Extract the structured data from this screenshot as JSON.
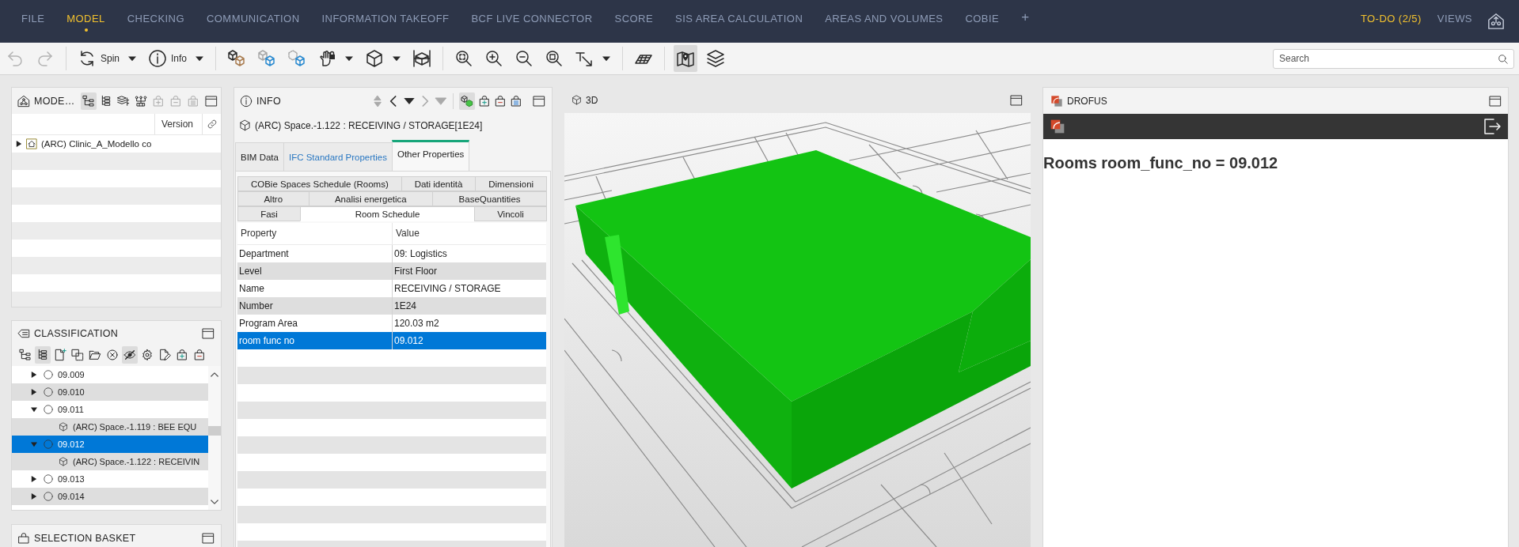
{
  "menu_bar": {
    "items": [
      {
        "label": "FILE",
        "selected": false
      },
      {
        "label": "MODEL",
        "selected": true
      },
      {
        "label": "CHECKING",
        "selected": false
      },
      {
        "label": "COMMUNICATION",
        "selected": false
      },
      {
        "label": "INFORMATION TAKEOFF",
        "selected": false
      },
      {
        "label": "BCF LIVE CONNECTOR",
        "selected": false
      },
      {
        "label": "SCORE",
        "selected": false
      },
      {
        "label": "SIS AREA CALCULATION",
        "selected": false
      },
      {
        "label": "AREAS AND VOLUMES",
        "selected": false
      },
      {
        "label": "COBIE",
        "selected": false
      }
    ],
    "add_label": "+",
    "right_items": [
      {
        "label": "TO-DO (2/5)",
        "highlighted": true
      },
      {
        "label": "VIEWS",
        "highlighted": false
      }
    ]
  },
  "toolbar": {
    "tool_groups": [
      [
        {
          "kind": "undo",
          "pressed": false,
          "disabled": true,
          "dropdown": false
        },
        {
          "kind": "redo",
          "pressed": false,
          "disabled": true,
          "dropdown": false
        }
      ],
      [
        {
          "kind": "rotate",
          "label": "Spin",
          "pressed": false,
          "disabled": false,
          "dropdown": true
        },
        {
          "kind": "info",
          "label": "Info",
          "pressed": false,
          "disabled": false,
          "dropdown": true
        }
      ],
      [
        {
          "kind": "cubes",
          "pressed": false,
          "disabled": false,
          "dropdown": false
        },
        {
          "kind": "cubes-ghost",
          "pressed": false,
          "disabled": false,
          "dropdown": false
        },
        {
          "kind": "cubes-dashed",
          "pressed": false,
          "disabled": false,
          "dropdown": false
        },
        {
          "kind": "hand-lock",
          "pressed": false,
          "disabled": false,
          "dropdown": true
        },
        {
          "kind": "cube",
          "pressed": false,
          "disabled": false,
          "dropdown": true
        },
        {
          "kind": "section-box",
          "pressed": false,
          "disabled": false,
          "dropdown": false
        }
      ],
      [
        {
          "kind": "zoom-fit",
          "pressed": false,
          "disabled": false,
          "dropdown": false
        },
        {
          "kind": "zoom-in",
          "pressed": false,
          "disabled": false,
          "dropdown": false
        },
        {
          "kind": "zoom-out",
          "pressed": false,
          "disabled": false,
          "dropdown": false
        },
        {
          "kind": "zoom-window",
          "pressed": false,
          "disabled": false,
          "dropdown": false
        },
        {
          "kind": "measure",
          "pressed": false,
          "disabled": false,
          "dropdown": true
        }
      ],
      [
        {
          "kind": "plane",
          "pressed": false,
          "disabled": false,
          "dropdown": false
        }
      ],
      [
        {
          "kind": "map",
          "pressed": true,
          "disabled": false,
          "dropdown": false
        },
        {
          "kind": "layers",
          "pressed": false,
          "disabled": false,
          "dropdown": false
        }
      ]
    ],
    "search": {
      "placeholder": "Search"
    }
  },
  "models_panel": {
    "title": "MODE…",
    "tools": [
      {
        "kind": "hierarchy",
        "pressed": true,
        "disabled": false
      },
      {
        "kind": "tree",
        "pressed": false,
        "disabled": false
      },
      {
        "kind": "layers-tree",
        "pressed": false,
        "disabled": false
      },
      {
        "kind": "network",
        "pressed": false,
        "disabled": false
      },
      {
        "kind": "bag-plus",
        "pressed": false,
        "disabled": true
      },
      {
        "kind": "bag-minus",
        "pressed": false,
        "disabled": true
      },
      {
        "kind": "bag-list",
        "pressed": false,
        "disabled": true
      }
    ],
    "columns": [
      "Version"
    ],
    "rows": [
      {
        "label": "(ARC) Clinic_A_Modello co",
        "expanded": false
      }
    ]
  },
  "classification_panel": {
    "title": "CLASSIFICATION",
    "tools": [
      {
        "kind": "hierarchy",
        "pressed": false,
        "disabled": false
      },
      {
        "kind": "tree",
        "pressed": true,
        "disabled": false
      },
      {
        "kind": "file-plus",
        "pressed": false,
        "disabled": false
      },
      {
        "kind": "copy-dashed",
        "pressed": false,
        "disabled": false
      },
      {
        "kind": "folder-open",
        "pressed": false,
        "disabled": false
      },
      {
        "kind": "circle-x",
        "pressed": false,
        "disabled": false
      },
      {
        "kind": "eye-slash",
        "pressed": true,
        "disabled": false
      },
      {
        "kind": "gear",
        "pressed": false,
        "disabled": false
      },
      {
        "kind": "edit-doc",
        "pressed": false,
        "disabled": false
      },
      {
        "kind": "bag-plus",
        "pressed": false,
        "disabled": false
      },
      {
        "kind": "bag-minus",
        "pressed": false,
        "disabled": false
      }
    ],
    "tree": [
      {
        "kind": "group",
        "label": "09.009",
        "expanded": false,
        "selected": false
      },
      {
        "kind": "group",
        "label": "09.010",
        "expanded": false,
        "selected": false
      },
      {
        "kind": "group",
        "label": "09.011",
        "expanded": true,
        "selected": false,
        "children": [
          {
            "kind": "element",
            "label": "(ARC) Space.-1.119 : BEE EQU",
            "selected": false
          }
        ]
      },
      {
        "kind": "group",
        "label": "09.012",
        "expanded": true,
        "selected": true,
        "children": [
          {
            "kind": "element",
            "label": "(ARC) Space.-1.122 : RECEIVIN",
            "selected": false
          }
        ]
      },
      {
        "kind": "group",
        "label": "09.013",
        "expanded": false,
        "selected": false
      },
      {
        "kind": "group",
        "label": "09.014",
        "expanded": false,
        "selected": false
      }
    ]
  },
  "selection_basket": {
    "title": "SELECTION BASKET"
  },
  "info_panel": {
    "title": "INFO",
    "tool_groups": [
      [
        {
          "kind": "sort",
          "pressed": false,
          "disabled": true
        },
        {
          "kind": "chevron-left",
          "pressed": false,
          "disabled": false
        },
        {
          "kind": "triangle-down",
          "pressed": false,
          "disabled": false
        },
        {
          "kind": "chevron-right",
          "pressed": false,
          "disabled": true
        },
        {
          "kind": "triangle-down",
          "pressed": false,
          "disabled": true
        }
      ],
      [
        {
          "kind": "cubes-color",
          "pressed": true,
          "disabled": false
        },
        {
          "kind": "bag-plus",
          "pressed": false,
          "disabled": false
        },
        {
          "kind": "bag-minus",
          "pressed": false,
          "disabled": false
        },
        {
          "kind": "bag-list",
          "pressed": false,
          "disabled": false
        }
      ]
    ],
    "object": "(ARC) Space.-1.122 : RECEIVING / STORAGE[1E24]",
    "tabs": [
      {
        "label": "BIM Data",
        "selected": false,
        "hovered": false
      },
      {
        "label": "IFC Standard Properties",
        "selected": false,
        "hovered": true
      },
      {
        "label": "Other Properties",
        "selected": true,
        "hovered": false
      }
    ],
    "property_sets": [
      [
        {
          "label": "COBie Spaces Schedule (Rooms)",
          "selected": false
        },
        {
          "label": "Dati identità",
          "selected": false
        },
        {
          "label": "Dimensioni",
          "selected": false
        }
      ],
      [
        {
          "label": "Altro",
          "selected": false
        },
        {
          "label": "Analisi energetica",
          "selected": false
        },
        {
          "label": "BaseQuantities",
          "selected": false
        }
      ],
      [
        {
          "label": "Fasi",
          "selected": false
        },
        {
          "label": "Room Schedule",
          "selected": true
        },
        {
          "label": "Vincoli",
          "selected": false
        }
      ]
    ],
    "table": {
      "columns": [
        "Property",
        "Value"
      ],
      "rows": [
        {
          "cells": [
            "Department",
            "09: Logistics"
          ],
          "selected": false
        },
        {
          "cells": [
            "Level",
            "First Floor"
          ],
          "selected": false
        },
        {
          "cells": [
            "Name",
            "RECEIVING / STORAGE"
          ],
          "selected": false
        },
        {
          "cells": [
            "Number",
            "1E24"
          ],
          "selected": false
        },
        {
          "cells": [
            "Program Area",
            "120.03 m2"
          ],
          "selected": false
        },
        {
          "cells": [
            "room func no",
            "09.012"
          ],
          "selected": true
        }
      ]
    }
  },
  "viewer_panel": {
    "title": "3D"
  },
  "drofus_panel": {
    "title": "DROFUS",
    "heading": "Rooms room_func_no = 09.012"
  }
}
